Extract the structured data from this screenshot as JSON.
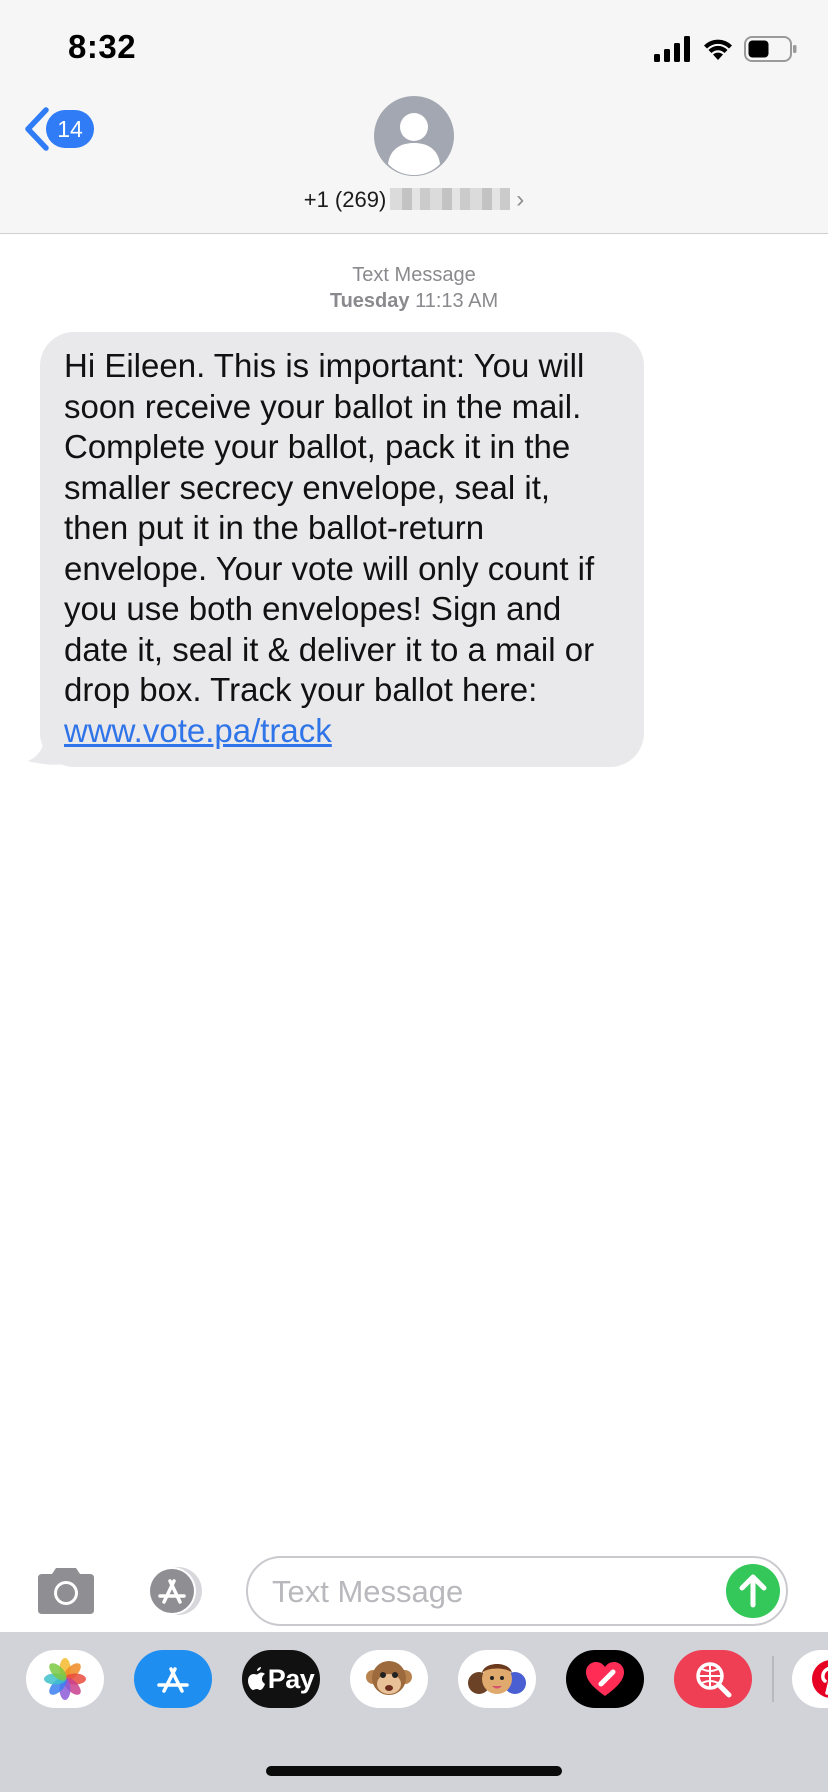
{
  "status_bar": {
    "time": "8:32",
    "icons": [
      "signal-icon",
      "wifi-icon",
      "battery-icon"
    ],
    "battery_level": 0.5
  },
  "header": {
    "back_count": "14",
    "contact_number_visible": "+1 (269)",
    "contact_number_redacted": true,
    "avatar_icon": "person-icon"
  },
  "conversation": {
    "timestamp_label": "Text Message",
    "timestamp_day": "Tuesday",
    "timestamp_time": "11:13 AM",
    "messages": [
      {
        "direction": "incoming",
        "text": "Hi Eileen. This is important: You will soon receive your ballot in the mail. Complete your ballot, pack it in the smaller secrecy envelope, seal it, then put it in the ballot-return envelope. Your vote will only count if you use both envelopes! Sign and date it, seal it & deliver it to a mail or drop box. Track your ballot here:",
        "link": "www.vote.pa/track"
      }
    ]
  },
  "compose": {
    "placeholder": "Text Message",
    "value": ""
  },
  "app_drawer": {
    "apple_pay_label": "Pay",
    "apps": [
      "photos",
      "app-store",
      "apple-pay",
      "animoji",
      "memoji",
      "digital-touch",
      "web-search",
      "pinterest"
    ]
  },
  "colors": {
    "accent": "#2f7cf6",
    "link": "#2f74e8",
    "incoming_bubble": "#e9e9eb",
    "send": "#34c759",
    "drawer_bg": "#d1d3d9"
  }
}
